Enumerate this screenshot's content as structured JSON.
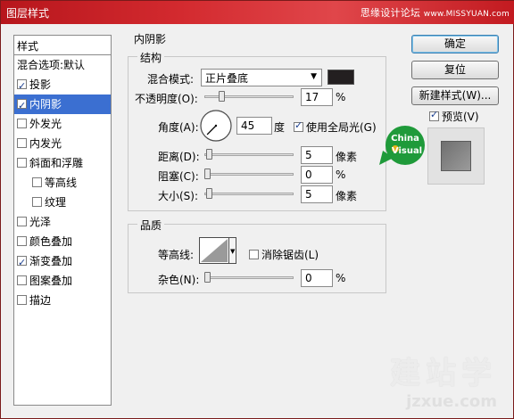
{
  "window": {
    "title": "图层样式"
  },
  "watermark": {
    "top": "思缘设计论坛",
    "top_sub": "www.MISSYUAN.com"
  },
  "sidebar": {
    "header": "样式",
    "items": [
      {
        "label": "混合选项:默认",
        "checkbox": false,
        "checked": false,
        "indent": false,
        "selected": false
      },
      {
        "label": "投影",
        "checkbox": true,
        "checked": true,
        "indent": false,
        "selected": false
      },
      {
        "label": "内阴影",
        "checkbox": true,
        "checked": true,
        "indent": false,
        "selected": true
      },
      {
        "label": "外发光",
        "checkbox": true,
        "checked": false,
        "indent": false,
        "selected": false
      },
      {
        "label": "内发光",
        "checkbox": true,
        "checked": false,
        "indent": false,
        "selected": false
      },
      {
        "label": "斜面和浮雕",
        "checkbox": true,
        "checked": false,
        "indent": false,
        "selected": false
      },
      {
        "label": "等高线",
        "checkbox": true,
        "checked": false,
        "indent": true,
        "selected": false
      },
      {
        "label": "纹理",
        "checkbox": true,
        "checked": false,
        "indent": true,
        "selected": false
      },
      {
        "label": "光泽",
        "checkbox": true,
        "checked": false,
        "indent": false,
        "selected": false
      },
      {
        "label": "颜色叠加",
        "checkbox": true,
        "checked": false,
        "indent": false,
        "selected": false
      },
      {
        "label": "渐变叠加",
        "checkbox": true,
        "checked": true,
        "indent": false,
        "selected": false
      },
      {
        "label": "图案叠加",
        "checkbox": true,
        "checked": false,
        "indent": false,
        "selected": false
      },
      {
        "label": "描边",
        "checkbox": true,
        "checked": false,
        "indent": false,
        "selected": false
      }
    ]
  },
  "inner_shadow": {
    "section_title": "内阴影",
    "structure": {
      "title": "结构",
      "blend_mode_label": "混合模式:",
      "blend_mode_value": "正片叠底",
      "blend_color": "#231f20",
      "opacity_label": "不透明度(O):",
      "opacity_value": "17",
      "opacity_unit": "%",
      "opacity_fraction": 0.17,
      "angle_label": "角度(A):",
      "angle_value": "45",
      "angle_unit": "度",
      "global_light_label": "使用全局光(G)",
      "global_light_checked": true,
      "distance_label": "距离(D):",
      "distance_value": "5",
      "distance_unit": "像素",
      "distance_fraction": 0.02,
      "choke_label": "阻塞(C):",
      "choke_value": "0",
      "choke_unit": "%",
      "choke_fraction": 0.0,
      "size_label": "大小(S):",
      "size_value": "5",
      "size_unit": "像素",
      "size_fraction": 0.02
    },
    "quality": {
      "title": "品质",
      "contour_label": "等高线:",
      "antialias_label": "消除锯齿(L)",
      "antialias_checked": false,
      "noise_label": "杂色(N):",
      "noise_value": "0",
      "noise_unit": "%",
      "noise_fraction": 0.0
    }
  },
  "buttons": {
    "ok": "确定",
    "reset": "复位",
    "new_style": "新建样式(W)...",
    "preview_label": "预览(V)",
    "preview_checked": true
  },
  "badge": {
    "line1": "China",
    "line2": "Visual"
  },
  "footer_watermark": {
    "big": "建站学",
    "small": "jzxue.com"
  }
}
